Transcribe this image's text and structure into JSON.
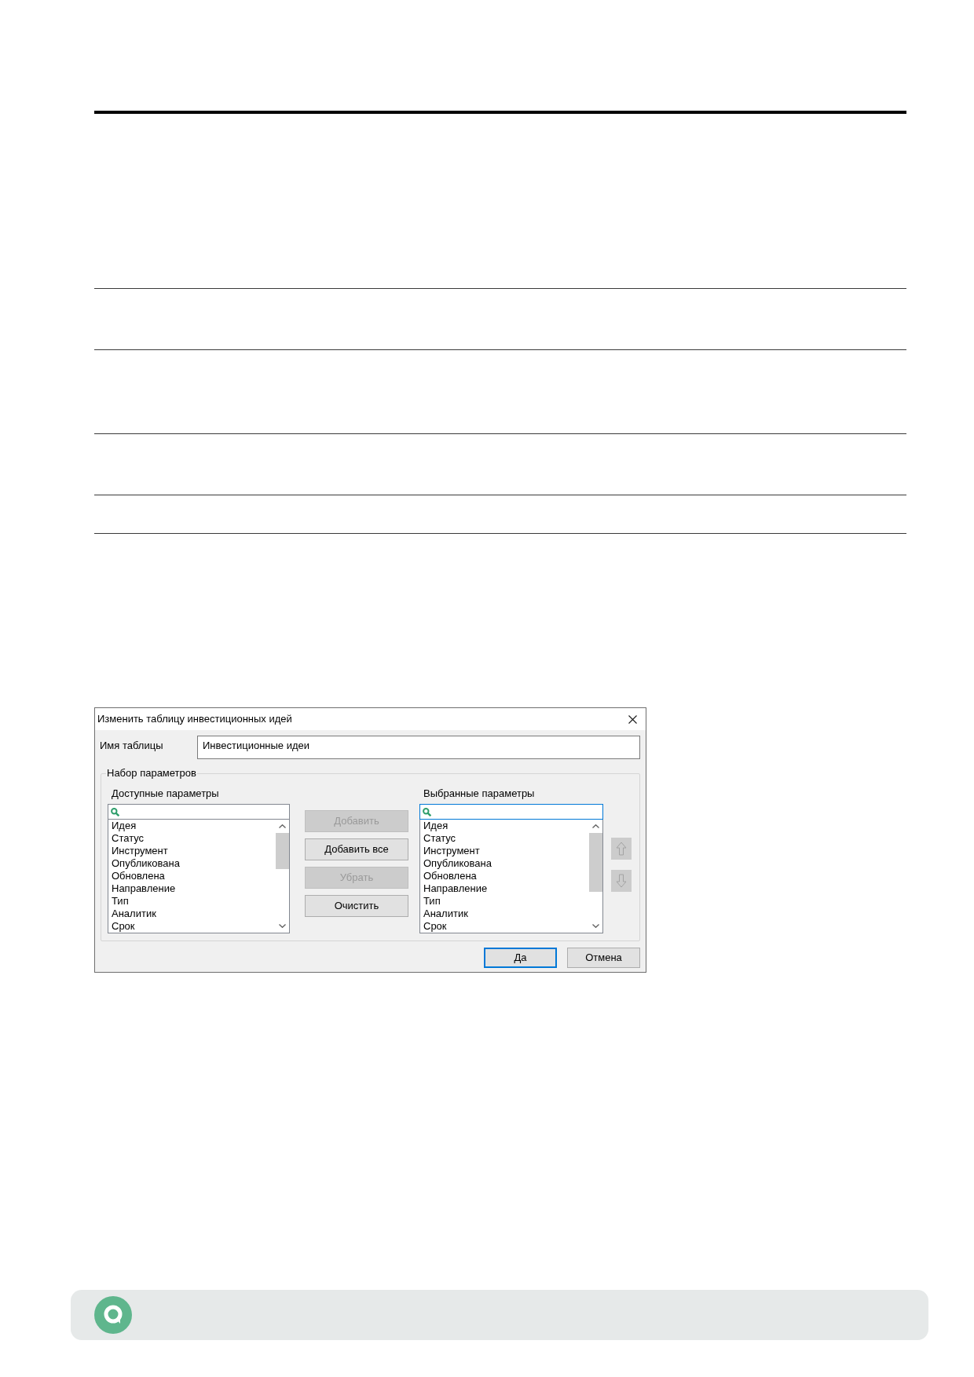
{
  "dialog": {
    "title": "Изменить таблицу инвестиционных идей",
    "name_field": {
      "label": "Имя таблицы",
      "value": "Инвестиционные идеи"
    },
    "parameters": {
      "title": "Набор параметров",
      "available_list": {
        "label": "Доступные параметры",
        "search_focused": false,
        "items": [
          {
            "label": "Идея",
            "selected": false
          },
          {
            "label": "Статус",
            "selected": false
          },
          {
            "label": "Инструмент",
            "selected": false
          },
          {
            "label": "Опубликована",
            "selected": false
          },
          {
            "label": "Обновлена",
            "selected": false
          },
          {
            "label": "Направление",
            "selected": false
          },
          {
            "label": "Тип",
            "selected": false
          },
          {
            "label": "Аналитик",
            "selected": false
          },
          {
            "label": "Срок",
            "selected": false
          }
        ]
      },
      "actions": [
        {
          "label": "Добавить",
          "disabled": true
        },
        {
          "label": "Добавить все",
          "disabled": false
        },
        {
          "label": "Убрать",
          "disabled": true
        },
        {
          "label": "Очистить",
          "disabled": false
        }
      ],
      "selected_list": {
        "label": "Выбранные параметры",
        "search_focused": true,
        "items": [
          {
            "label": "Идея",
            "selected": false
          },
          {
            "label": "Статус",
            "selected": false
          },
          {
            "label": "Инструмент",
            "selected": false
          },
          {
            "label": "Опубликована",
            "selected": false
          },
          {
            "label": "Обновлена",
            "selected": false
          },
          {
            "label": "Направление",
            "selected": false
          },
          {
            "label": "Тип",
            "selected": false
          },
          {
            "label": "Аналитик",
            "selected": false
          },
          {
            "label": "Срок",
            "selected": false
          }
        ]
      },
      "order_buttons": [
        {
          "kind": "up",
          "disabled": true
        },
        {
          "kind": "down",
          "disabled": true
        }
      ]
    },
    "buttons": [
      {
        "label": "Да",
        "default": true
      },
      {
        "label": "Отмена",
        "default": false
      }
    ]
  }
}
